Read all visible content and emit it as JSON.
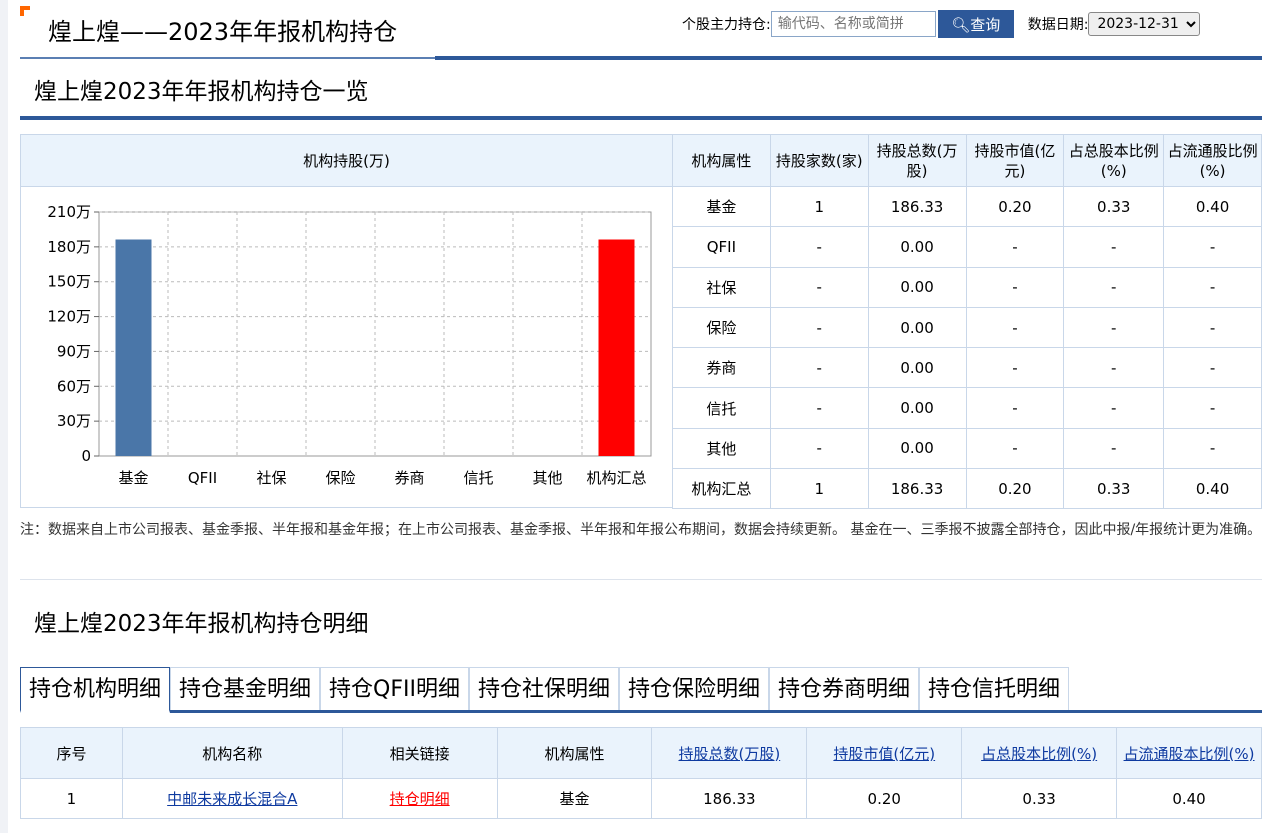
{
  "header": {
    "title": "煌上煌——2023年年报机构持仓",
    "search_label": "个股主力持仓:",
    "search_placeholder": "输代码、名称或简拼",
    "search_button": "查询",
    "date_label": "数据日期:",
    "date_value": "2023-12-31"
  },
  "overview": {
    "title": "煌上煌2023年年报机构持仓一览",
    "chart_header": "机构持股(万)",
    "columns": [
      "机构属性",
      "持股家数(家)",
      "持股总数(万股)",
      "持股市值(亿元)",
      "占总股本比例(%)",
      "占流通股比例(%)"
    ],
    "rows": [
      [
        "基金",
        "1",
        "186.33",
        "0.20",
        "0.33",
        "0.40"
      ],
      [
        "QFII",
        "-",
        "0.00",
        "-",
        "-",
        "-"
      ],
      [
        "社保",
        "-",
        "0.00",
        "-",
        "-",
        "-"
      ],
      [
        "保险",
        "-",
        "0.00",
        "-",
        "-",
        "-"
      ],
      [
        "券商",
        "-",
        "0.00",
        "-",
        "-",
        "-"
      ],
      [
        "信托",
        "-",
        "0.00",
        "-",
        "-",
        "-"
      ],
      [
        "其他",
        "-",
        "0.00",
        "-",
        "-",
        "-"
      ],
      [
        "机构汇总",
        "1",
        "186.33",
        "0.20",
        "0.33",
        "0.40"
      ]
    ],
    "note": "注：数据来自上市公司报表、基金季报、半年报和基金年报；在上市公司报表、基金季报、半年报和年报公布期间，数据会持续更新。 基金在一、三季报不披露全部持仓，因此中报/年报统计更为准确。"
  },
  "chart_data": {
    "type": "bar",
    "title": "机构持股(万)",
    "categories": [
      "基金",
      "QFII",
      "社保",
      "保险",
      "券商",
      "信托",
      "其他",
      "机构汇总"
    ],
    "values": [
      186.33,
      0,
      0,
      0,
      0,
      0,
      0,
      186.33
    ],
    "colors": [
      "#4a76a8",
      "#4a76a8",
      "#4a76a8",
      "#4a76a8",
      "#4a76a8",
      "#4a76a8",
      "#4a76a8",
      "#ff0000"
    ],
    "yticks": [
      "0",
      "30万",
      "60万",
      "90万",
      "120万",
      "150万",
      "180万",
      "210万"
    ],
    "ylim": [
      0,
      210
    ],
    "grid": true
  },
  "detail": {
    "title": "煌上煌2023年年报机构持仓明细",
    "tabs": [
      "持仓机构明细",
      "持仓基金明细",
      "持仓QFII明细",
      "持仓社保明细",
      "持仓保险明细",
      "持仓券商明细",
      "持仓信托明细"
    ],
    "columns": [
      "序号",
      "机构名称",
      "相关链接",
      "机构属性",
      "持股总数(万股)",
      "持股市值(亿元)",
      "占总股本比例(%)",
      "占流通股本比例(%)"
    ],
    "rows": [
      [
        "1",
        "中邮未来成长混合A",
        "持仓明细",
        "基金",
        "186.33",
        "0.20",
        "0.33",
        "0.40"
      ]
    ]
  }
}
